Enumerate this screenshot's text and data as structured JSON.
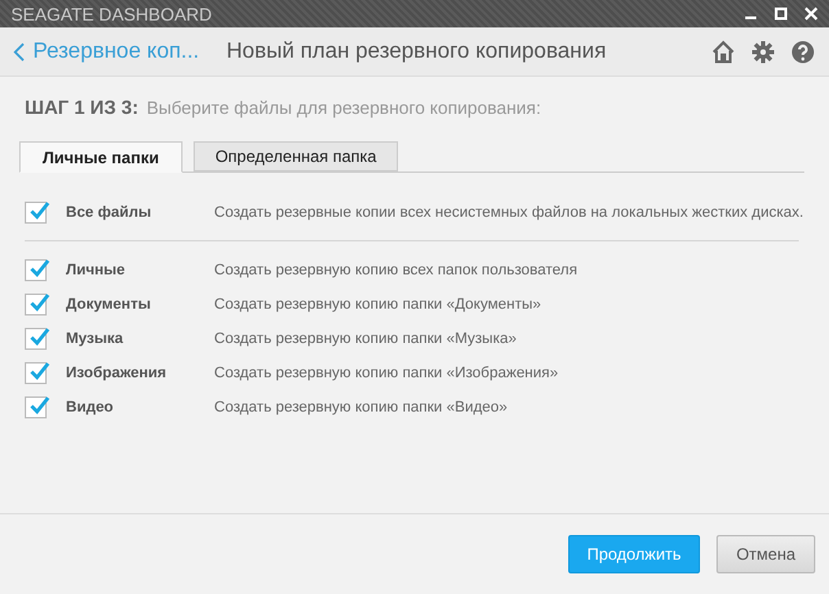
{
  "window": {
    "title": "SEAGATE DASHBOARD"
  },
  "header": {
    "back_link": "Резервное коп...",
    "title": "Новый план резервного копирования"
  },
  "step": {
    "label": "ШАГ 1 ИЗ 3:",
    "text": "Выберите файлы для резервного копирования:"
  },
  "tabs": [
    {
      "label": "Личные папки",
      "selected": true
    },
    {
      "label": "Определенная папка",
      "selected": false
    }
  ],
  "all_files": {
    "name": "Все файлы",
    "description": "Создать резервные копии всех несистемных файлов на локальных жестких дисках.",
    "checked": true
  },
  "folders": [
    {
      "name": "Личные",
      "description": "Создать резервную копию всех папок пользователя",
      "checked": true
    },
    {
      "name": "Документы",
      "description": "Создать резервную копию папки «Документы»",
      "checked": true
    },
    {
      "name": "Музыка",
      "description": "Создать резервную копию папки «Музыка»",
      "checked": true
    },
    {
      "name": "Изображения",
      "description": "Создать резервную копию папки «Изображения»",
      "checked": true
    },
    {
      "name": "Видео",
      "description": "Создать резервную копию папки «Видео»",
      "checked": true
    }
  ],
  "buttons": [
    {
      "label": "Продолжить",
      "kind": "primary"
    },
    {
      "label": "Отмена",
      "kind": "secondary"
    }
  ]
}
